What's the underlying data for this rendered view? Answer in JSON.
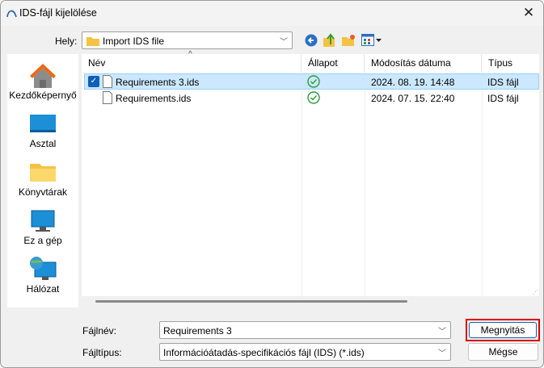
{
  "window": {
    "title": "IDS-fájl kijelölése",
    "close_icon": "close-icon"
  },
  "location": {
    "label": "Hely:",
    "value": "Import IDS file"
  },
  "sidebar": {
    "items": [
      {
        "label": "Kezdőképernyő",
        "icon": "home-icon"
      },
      {
        "label": "Asztal",
        "icon": "desktop-icon"
      },
      {
        "label": "Könyvtárak",
        "icon": "folder-icon"
      },
      {
        "label": "Ez a gép",
        "icon": "computer-icon"
      },
      {
        "label": "Hálózat",
        "icon": "network-icon"
      }
    ]
  },
  "columns": [
    "Név",
    "Állapot",
    "Módosítás dátuma",
    "Típus"
  ],
  "files": [
    {
      "name": "Requirements 3.ids",
      "date": "2024. 08. 19. 14:48",
      "type": "IDS fájl",
      "selected": true
    },
    {
      "name": "Requirements.ids",
      "date": "2024. 07. 15. 22:40",
      "type": "IDS fájl",
      "selected": false
    }
  ],
  "filename": {
    "label": "Fájlnév:",
    "value": "Requirements 3"
  },
  "filetype": {
    "label": "Fájltípus:",
    "value": "Információátadás-specifikációs fájl (IDS) (*.ids)"
  },
  "buttons": {
    "open": "Megnyitás",
    "cancel": "Mégse"
  },
  "colors": {
    "highlight": "#e00000",
    "selection": "#cce8ff",
    "status_ok": "#2e9b3e"
  }
}
